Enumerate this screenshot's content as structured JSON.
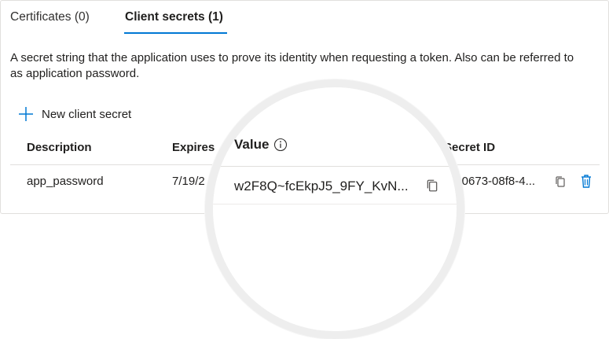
{
  "tabs": [
    {
      "label": "Certificates (0)",
      "active": false
    },
    {
      "label": "Client secrets (1)",
      "active": true
    }
  ],
  "description": "A secret string that the application uses to prove its identity when requesting a token. Also can be referred to as application password.",
  "new_secret_label": "New client secret",
  "table": {
    "headers": {
      "description": "Description",
      "expires": "Expires",
      "value": "Value",
      "secret_id": "Secret ID"
    },
    "rows": [
      {
        "description": "app_password",
        "expires": "7/19/2",
        "value": "w2F8Q~fcEkpJ5_9FY_KvN...",
        "secret_id": "1b0673-08f8-4..."
      }
    ]
  },
  "colors": {
    "accent": "#0078d4",
    "text": "#201f1e",
    "border": "#e1dfdd"
  },
  "icons": {
    "plus": "plus-icon",
    "info": "info-icon",
    "copy": "copy-icon",
    "delete": "trash-icon"
  }
}
